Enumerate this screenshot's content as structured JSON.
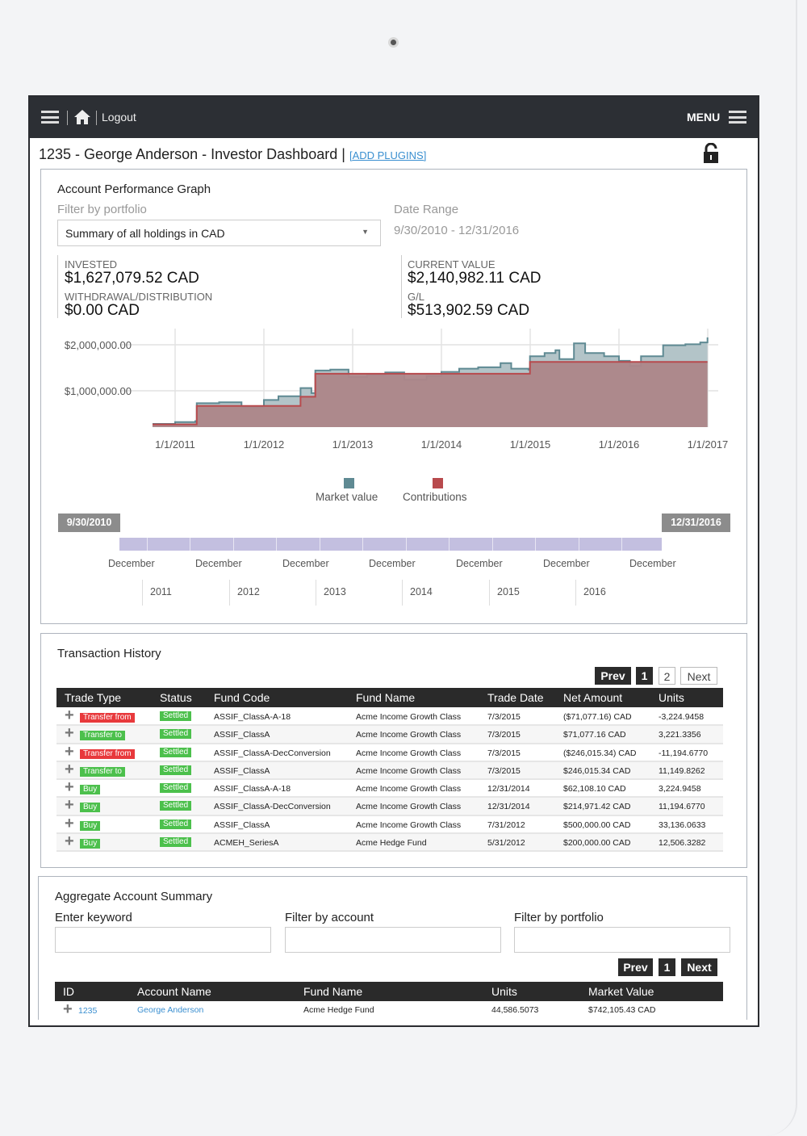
{
  "topbar": {
    "logout": "Logout",
    "menu": "MENU"
  },
  "header": {
    "title": "1235 - George Anderson - Investor Dashboard",
    "separator": "|",
    "add_plugins": "[ADD PLUGINS]"
  },
  "performance": {
    "title": "Account Performance Graph",
    "filter_label": "Filter by portfolio",
    "filter_value": "Summary of all holdings in CAD",
    "date_range_label": "Date Range",
    "date_range_value": "9/30/2010 - 12/31/2016",
    "invested_label": "INVESTED",
    "invested_value": "$1,627,079.52 CAD",
    "withdrawal_label": "WITHDRAWAL/DISTRIBUTION",
    "withdrawal_value": "$0.00 CAD",
    "current_label": "CURRENT VALUE",
    "current_value": "$2,140,982.11 CAD",
    "gl_label": "G/L",
    "gl_value": "$513,902.59 CAD"
  },
  "chart_data": {
    "type": "area",
    "y_tick_labels": [
      "$2,000,000.00",
      "$1,000,000.00"
    ],
    "y_ticks": [
      2000000,
      1000000
    ],
    "ylim": [
      210000,
      2350000
    ],
    "x_tick_labels": [
      "1/1/2011",
      "1/1/2012",
      "1/1/2013",
      "1/1/2014",
      "1/1/2015",
      "1/1/2016",
      "1/1/2017"
    ],
    "x_ticks": [
      "2011-01-01",
      "2012-01-01",
      "2013-01-01",
      "2014-01-01",
      "2015-01-01",
      "2016-01-01",
      "2017-01-01"
    ],
    "grid": true,
    "legend_position": "bottom",
    "series": [
      {
        "name": "Market value",
        "color": "#5f8a93",
        "step": true,
        "points": [
          [
            "2010-09-30",
            280000
          ],
          [
            "2011-01-01",
            320000
          ],
          [
            "2011-03-25",
            340000
          ],
          [
            "2011-03-31",
            730000
          ],
          [
            "2011-07-01",
            750000
          ],
          [
            "2011-10-01",
            640000
          ],
          [
            "2012-01-01",
            800000
          ],
          [
            "2012-03-01",
            880000
          ],
          [
            "2012-05-15",
            880000
          ],
          [
            "2012-05-31",
            1060000
          ],
          [
            "2012-07-15",
            950000
          ],
          [
            "2012-07-31",
            1440000
          ],
          [
            "2012-10-01",
            1460000
          ],
          [
            "2012-12-15",
            1300000
          ],
          [
            "2013-03-01",
            1350000
          ],
          [
            "2013-05-15",
            1400000
          ],
          [
            "2013-08-01",
            1240000
          ],
          [
            "2013-11-01",
            1320000
          ],
          [
            "2014-01-01",
            1410000
          ],
          [
            "2014-03-15",
            1480000
          ],
          [
            "2014-06-01",
            1510000
          ],
          [
            "2014-09-01",
            1600000
          ],
          [
            "2014-10-15",
            1480000
          ],
          [
            "2014-12-25",
            1460000
          ],
          [
            "2014-12-31",
            1750000
          ],
          [
            "2015-03-01",
            1820000
          ],
          [
            "2015-04-15",
            1880000
          ],
          [
            "2015-05-01",
            1690000
          ],
          [
            "2015-06-30",
            2030000
          ],
          [
            "2015-08-15",
            1820000
          ],
          [
            "2015-11-01",
            1750000
          ],
          [
            "2016-01-01",
            1650000
          ],
          [
            "2016-02-15",
            1540000
          ],
          [
            "2016-04-01",
            1750000
          ],
          [
            "2016-07-01",
            1990000
          ],
          [
            "2016-10-01",
            2010000
          ],
          [
            "2016-12-01",
            2050000
          ],
          [
            "2016-12-31",
            2160000
          ]
        ]
      },
      {
        "name": "Contributions",
        "color": "#b84a4d",
        "step": true,
        "points": [
          [
            "2010-09-30",
            270000
          ],
          [
            "2011-03-31",
            670000
          ],
          [
            "2012-05-31",
            870000
          ],
          [
            "2012-07-31",
            1370000
          ],
          [
            "2014-12-31",
            1627080
          ],
          [
            "2016-12-31",
            1627080
          ]
        ]
      }
    ]
  },
  "slider": {
    "start": "9/30/2010",
    "end": "12/31/2016",
    "selected_fraction": [
      0,
      1
    ],
    "month_labels": [
      "December",
      "December",
      "December",
      "December",
      "December",
      "December",
      "December"
    ],
    "year_labels": [
      "2011",
      "2012",
      "2013",
      "2014",
      "2015",
      "2016"
    ],
    "track_color": "#c3bfe0"
  },
  "transactions": {
    "title": "Transaction History",
    "pagination": {
      "prev": "Prev",
      "pages": [
        "1",
        "2"
      ],
      "current": "1",
      "next": "Next"
    },
    "columns": [
      "Trade Type",
      "Status",
      "Fund Code",
      "Fund Name",
      "Trade Date",
      "Net Amount",
      "Units"
    ],
    "rows": [
      {
        "type": "Transfer from",
        "type_color": "#e8393c",
        "status": "Settled",
        "code": "ASSIF_ClassA-A-18",
        "fund": "Acme Income Growth Class",
        "date": "7/3/2015",
        "net": "($71,077.16) CAD",
        "units": "-3,224.9458"
      },
      {
        "type": "Transfer to",
        "type_color": "#4cc04c",
        "status": "Settled",
        "code": "ASSIF_ClassA",
        "fund": "Acme Income Growth Class",
        "date": "7/3/2015",
        "net": "$71,077.16 CAD",
        "units": "3,221.3356"
      },
      {
        "type": "Transfer from",
        "type_color": "#e8393c",
        "status": "Settled",
        "code": "ASSIF_ClassA-DecConversion",
        "fund": "Acme Income Growth Class",
        "date": "7/3/2015",
        "net": "($246,015.34) CAD",
        "units": "-11,194.6770"
      },
      {
        "type": "Transfer to",
        "type_color": "#4cc04c",
        "status": "Settled",
        "code": "ASSIF_ClassA",
        "fund": "Acme Income Growth Class",
        "date": "7/3/2015",
        "net": "$246,015.34 CAD",
        "units": "11,149.8262"
      },
      {
        "type": "Buy",
        "type_color": "#4cc04c",
        "status": "Settled",
        "code": "ASSIF_ClassA-A-18",
        "fund": "Acme Income Growth Class",
        "date": "12/31/2014",
        "net": "$62,108.10 CAD",
        "units": "3,224.9458"
      },
      {
        "type": "Buy",
        "type_color": "#4cc04c",
        "status": "Settled",
        "code": "ASSIF_ClassA-DecConversion",
        "fund": "Acme Income Growth Class",
        "date": "12/31/2014",
        "net": "$214,971.42 CAD",
        "units": "11,194.6770"
      },
      {
        "type": "Buy",
        "type_color": "#4cc04c",
        "status": "Settled",
        "code": "ASSIF_ClassA",
        "fund": "Acme Income Growth Class",
        "date": "7/31/2012",
        "net": "$500,000.00 CAD",
        "units": "33,136.0633"
      },
      {
        "type": "Buy",
        "type_color": "#4cc04c",
        "status": "Settled",
        "code": "ACMEH_SeriesA",
        "fund": "Acme Hedge Fund",
        "date": "5/31/2012",
        "net": "$200,000.00 CAD",
        "units": "12,506.3282"
      }
    ]
  },
  "aggregate": {
    "title": "Aggregate Account Summary",
    "keyword_label": "Enter keyword",
    "keyword_value": "",
    "account_label": "Filter by account",
    "account_value": "",
    "portfolio_label": "Filter by portfolio",
    "portfolio_value": "",
    "pagination": {
      "prev": "Prev",
      "current": "1",
      "next": "Next"
    },
    "columns": [
      "ID",
      "Account Name",
      "Fund Name",
      "Units",
      "Market Value"
    ],
    "rows": [
      {
        "id": "1235",
        "name": "George Anderson",
        "fund": "Acme Hedge Fund",
        "units": "44,586.5073",
        "value": "$742,105.43 CAD"
      }
    ]
  }
}
